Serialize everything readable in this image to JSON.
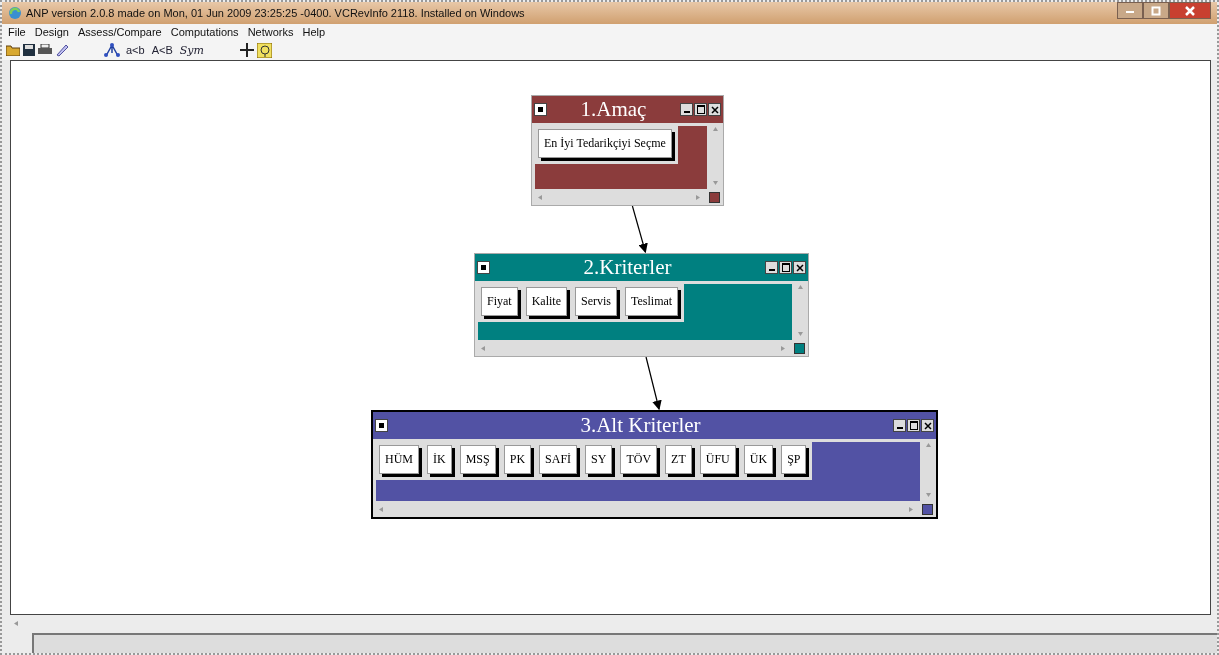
{
  "window": {
    "title": "ANP version 2.0.8 made on Mon, 01 Jun 2009 23:25:25 -0400.  VCRevInfo 2118.  Installed on Windows"
  },
  "menu": [
    "File",
    "Design",
    "Assess/Compare",
    "Computations",
    "Networks",
    "Help"
  ],
  "toolbar": [
    {
      "kind": "open"
    },
    {
      "kind": "save"
    },
    {
      "kind": "print"
    },
    {
      "kind": "pencil"
    },
    {
      "kind": "gap"
    },
    {
      "kind": "network"
    },
    {
      "kind": "text",
      "label": "a<b"
    },
    {
      "kind": "text",
      "label": "A<B"
    },
    {
      "kind": "italic",
      "label": "Sym"
    },
    {
      "kind": "gap"
    },
    {
      "kind": "cross"
    },
    {
      "kind": "help"
    }
  ],
  "clusters": [
    {
      "title": "1.Amaç",
      "color": "#8b3c3c",
      "selected": false,
      "arrow_to_next": true,
      "elements": [
        "En İyi Tedarikçiyi Seçme"
      ]
    },
    {
      "title": "2.Kriterler",
      "color": "#008080",
      "selected": false,
      "arrow_to_next": true,
      "elements": [
        "Fiyat",
        "Kalite",
        "Servis",
        "Teslimat"
      ]
    },
    {
      "title": "3.Alt Kriterler",
      "color": "#5252a4",
      "selected": true,
      "arrow_to_next": false,
      "elements": [
        "HÜM",
        "İK",
        "MSŞ",
        "PK",
        "SAFİ",
        "SY",
        "TÖV",
        "ZT",
        "ÜFU",
        "ÜK",
        "ŞP"
      ]
    }
  ]
}
